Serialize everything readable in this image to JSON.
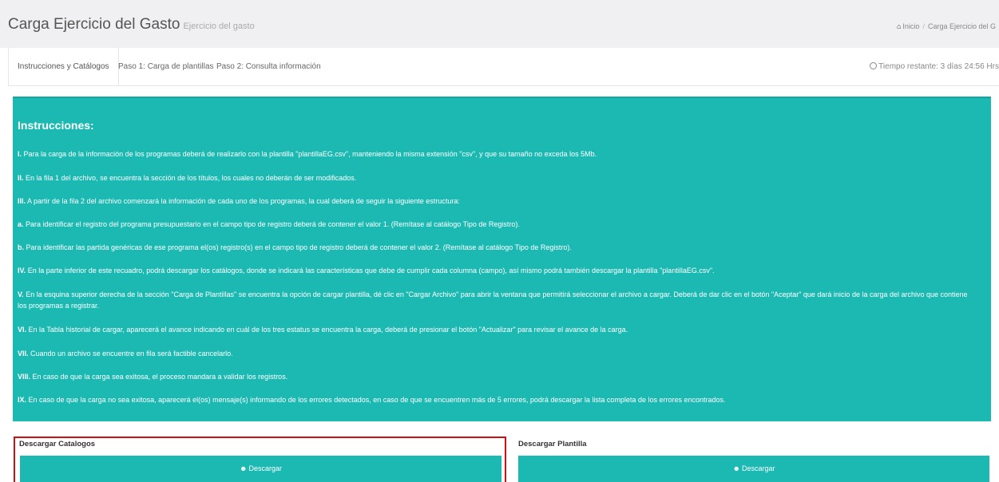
{
  "header": {
    "title": "Carga Ejercicio del Gasto",
    "subtitle": "Ejercicio del gasto",
    "breadcrumb": {
      "home": "Inicio",
      "current": "Carga Ejercicio del G"
    }
  },
  "tabs": [
    {
      "label": "Instrucciones y Catálogos",
      "active": true
    },
    {
      "label": "Paso 1: Carga de plantillas",
      "active": false
    },
    {
      "label": "Paso 2: Consulta información",
      "active": false
    }
  ],
  "timer": {
    "text": "Tiempo restante: 3 días 24:56 Hrs"
  },
  "instructions": {
    "title": "Instrucciones:",
    "items": [
      {
        "num": "I.",
        "text": " Para la carga de la información de los programas deberá de realizarlo con la plantilla \"plantillaEG.csv\", manteniendo la misma extensión \"csv\", y que su tamaño no exceda los 5Mb."
      },
      {
        "num": "II.",
        "text": " En la fila 1 del archivo, se encuentra la sección de los títulos, los cuales no deberán de ser modificados."
      },
      {
        "num": "III.",
        "text": " A partir de la fila 2 del archivo comenzará la información de cada uno de los programas, la cual deberá de seguir la siguiente estructura:"
      },
      {
        "num": "a.",
        "text": " Para identificar el registro del programa presupuestario en el campo tipo de registro deberá de contener el valor 1. (Remítase al catálogo Tipo de Registro)."
      },
      {
        "num": "b.",
        "text": " Para identificar las partida genéricas de ese programa el(os) registro(s) en el campo tipo de registro deberá de contener el valor 2. (Remítase al catálogo Tipo de Registro)."
      },
      {
        "num": "IV.",
        "text": " En la parte inferior de este recuadro, podrá descargar los catálogos, donde se indicará las características que debe de cumplir cada columna (campo), así mismo podrá también descargar la plantilla \"plantillaEG.csv\"."
      },
      {
        "num": "V.",
        "text": " En la esquina superior derecha de la sección \"Carga de Plantillas\" se encuentra la opción de cargar plantilla, dé clic en \"Cargar Archivo\" para abrir la ventana que permitirá seleccionar el archivo a cargar. Deberá de dar clic en el botón \"Aceptar\" que dará inicio de la carga del archivo que contiene los programas a registrar."
      },
      {
        "num": "VI.",
        "text": " En la Tabla historial de cargar, aparecerá el avance indicando en cuál de los tres estatus se encuentra la carga, deberá de presionar el botón \"Actualizar\" para revisar el avance de la carga."
      },
      {
        "num": "VII.",
        "text": " Cuando un archivo se encuentre en fila será factible cancelarlo."
      },
      {
        "num": "VIII.",
        "text": " En caso de que la carga sea exitosa, el proceso mandara a validar los registros."
      },
      {
        "num": "IX.",
        "text": " En caso de que la carga no sea exitosa, aparecerá el(os) mensaje(s) informando de los errores detectados, en caso de que se encuentren más de 5 errores, podrá descargar la lista completa de los errores encontrados."
      }
    ]
  },
  "downloads": {
    "catalogs": {
      "label": "Descargar Catalogos",
      "button": "Descargar"
    },
    "template": {
      "label": "Descargar Plantilla",
      "button": "Descargar"
    }
  },
  "colors": {
    "accent": "#1cb9b3",
    "highlight": "#cc1111"
  }
}
